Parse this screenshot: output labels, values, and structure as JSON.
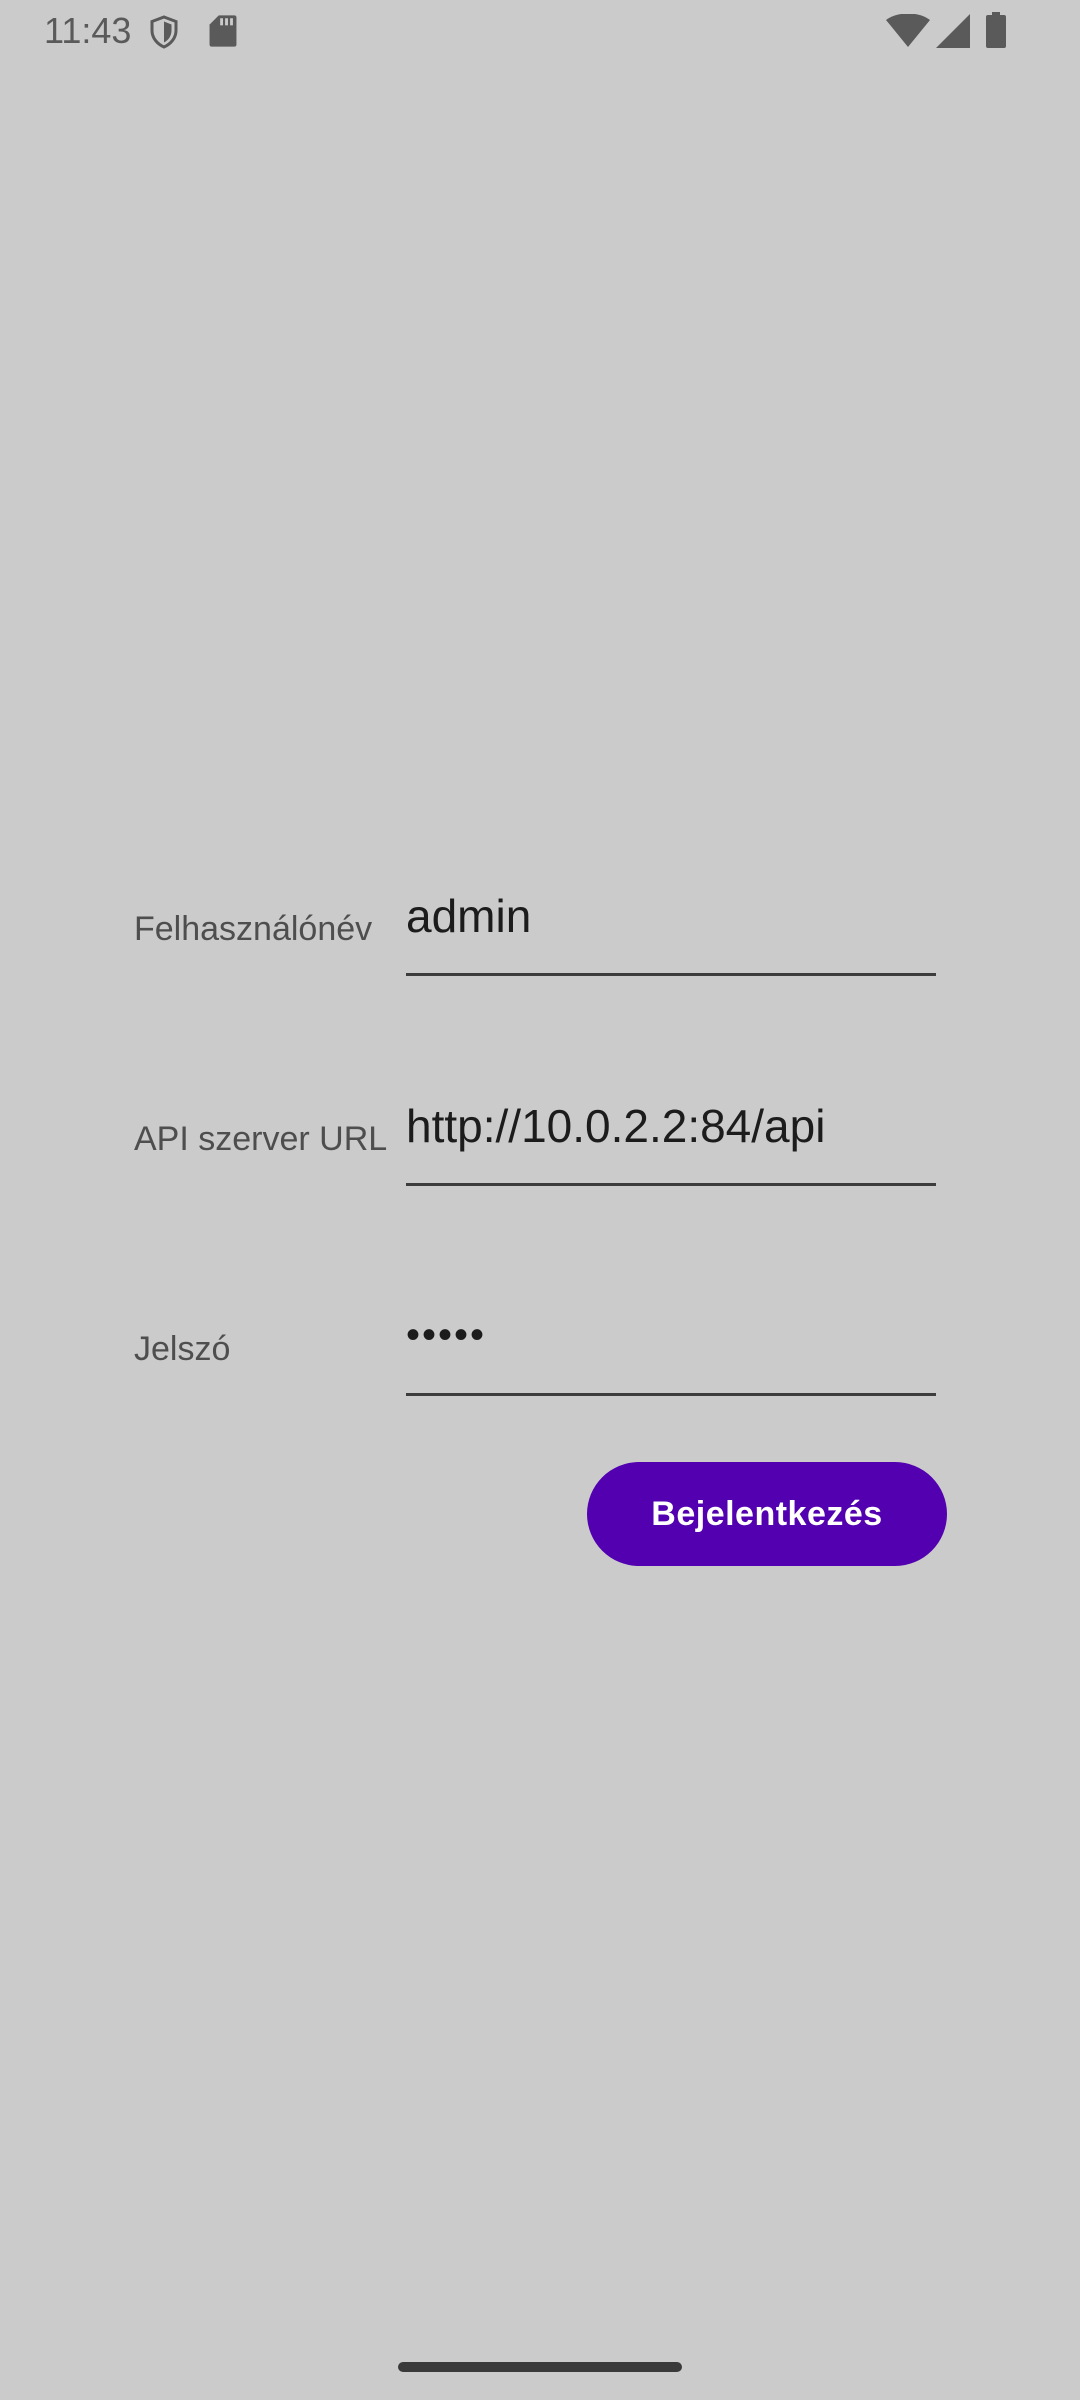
{
  "status_bar": {
    "time": "11:43",
    "left_icons": [
      "shield-icon",
      "sdcard-icon"
    ],
    "right_icons": [
      "wifi-icon",
      "signal-icon",
      "battery-icon"
    ]
  },
  "form": {
    "username": {
      "label": "Felhasználónév",
      "value": "admin"
    },
    "api_url": {
      "label": "API szerver URL",
      "value": "http://10.0.2.2:84/api"
    },
    "password": {
      "label": "Jelszó",
      "value": "•••••"
    },
    "login_button_label": "Bejelentkezés"
  },
  "colors": {
    "background": "#cbcbcb",
    "button": "#5200b0",
    "button_text": "#ffffff"
  }
}
